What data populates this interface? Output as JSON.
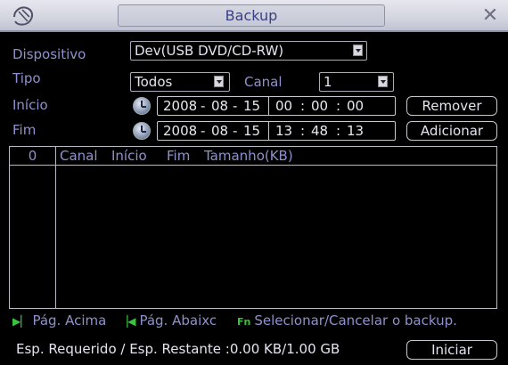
{
  "window": {
    "title": "Backup"
  },
  "form": {
    "device_label": "Dispositivo",
    "device_value": "Dev(USB DVD/CD-RW)",
    "type_label": "Tipo",
    "type_value": "Todos",
    "channel_label": "Canal",
    "channel_value": "1",
    "start_label": "Início",
    "end_label": "Fim",
    "start": {
      "year": "2008",
      "month": "08",
      "day": "15",
      "hour": "00",
      "minute": "00",
      "second": "00"
    },
    "end": {
      "year": "2008",
      "month": "08",
      "day": "15",
      "hour": "13",
      "minute": "48",
      "second": "13"
    },
    "remove_button": "Remover",
    "add_button": "Adicionar"
  },
  "table": {
    "count": "0",
    "columns": [
      "Canal",
      "Início",
      "Fim",
      "Tamanho(KB)"
    ],
    "rows": []
  },
  "hints": {
    "page_up": "Pág. Acima",
    "page_down": "Pág. Abaixc",
    "fn_key": "Fn",
    "select_cancel": "Selecionar/Cancelar o backup."
  },
  "footer": {
    "space_text": "Esp. Requerido / Esp. Restante :0.00 KB/1.00 GB",
    "start_button": "Iniciar"
  },
  "colors": {
    "label": "#8e91cc",
    "value": "#e4e4f0",
    "hint_icon": "#38c43c",
    "title": "#3b3f86"
  }
}
